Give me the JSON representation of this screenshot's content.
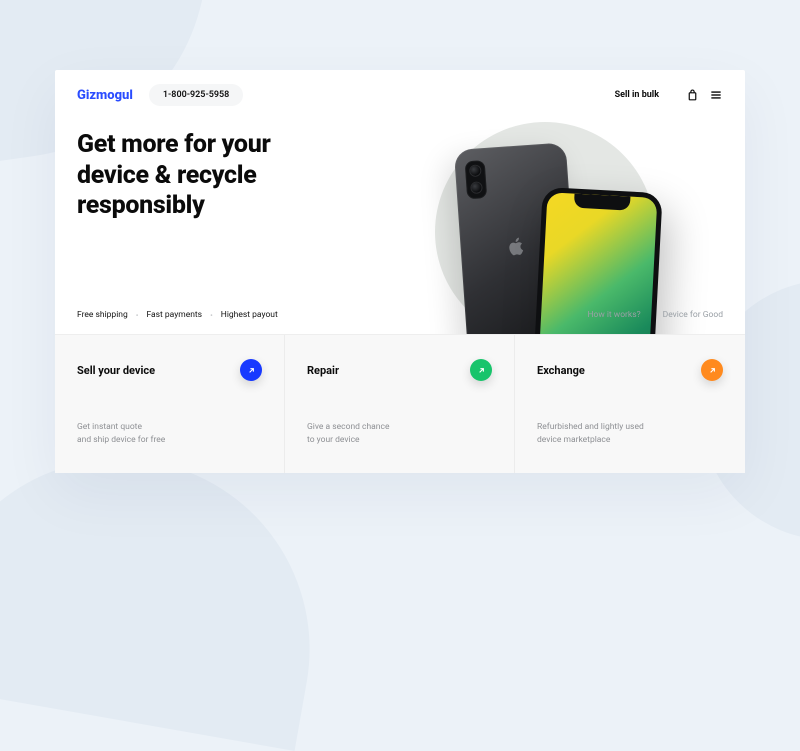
{
  "header": {
    "logo": "Gizmogul",
    "phone": "1-800-925-5958",
    "sell_bulk": "Sell in bulk"
  },
  "hero": {
    "title": "Get more for your\ndevice & recycle\nresponsibly",
    "features": [
      "Free shipping",
      "Fast payments",
      "Highest payout"
    ],
    "links": [
      "How it works?",
      "Device for Good"
    ]
  },
  "tiles": [
    {
      "title": "Sell your device",
      "desc": "Get instant quote\nand ship device for free",
      "color": "#1839ff"
    },
    {
      "title": "Repair",
      "desc": "Give a second chance\nto your device",
      "color": "#18c46b"
    },
    {
      "title": "Exchange",
      "desc": "Refurbished and lightly used\ndevice marketplace",
      "color": "#ff8a1e"
    }
  ]
}
